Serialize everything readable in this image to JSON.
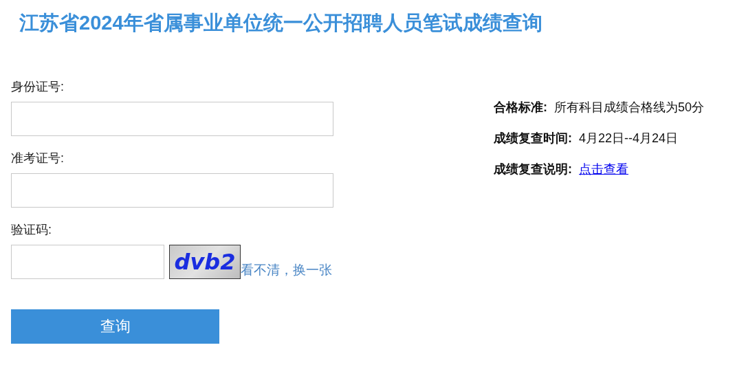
{
  "title": "江苏省2024年省属事业单位统一公开招聘人员笔试成绩查询",
  "form": {
    "fields": [
      {
        "label": "身份证号:",
        "kind": "text"
      },
      {
        "label": "准考证号:",
        "kind": "text"
      },
      {
        "label": "验证码:",
        "kind": "captcha",
        "captcha_text": "dvb2",
        "refresh_link": "看不清，换一张"
      }
    ],
    "submit": "查询"
  },
  "info": [
    {
      "label": "合格标准:",
      "value": "所有科目成绩合格线为50分",
      "kind": "text"
    },
    {
      "label": "成绩复查时间:",
      "value": "4月22日--4月24日",
      "kind": "text"
    },
    {
      "label": "成绩复查说明:",
      "value": "点击查看",
      "kind": "link"
    }
  ]
}
